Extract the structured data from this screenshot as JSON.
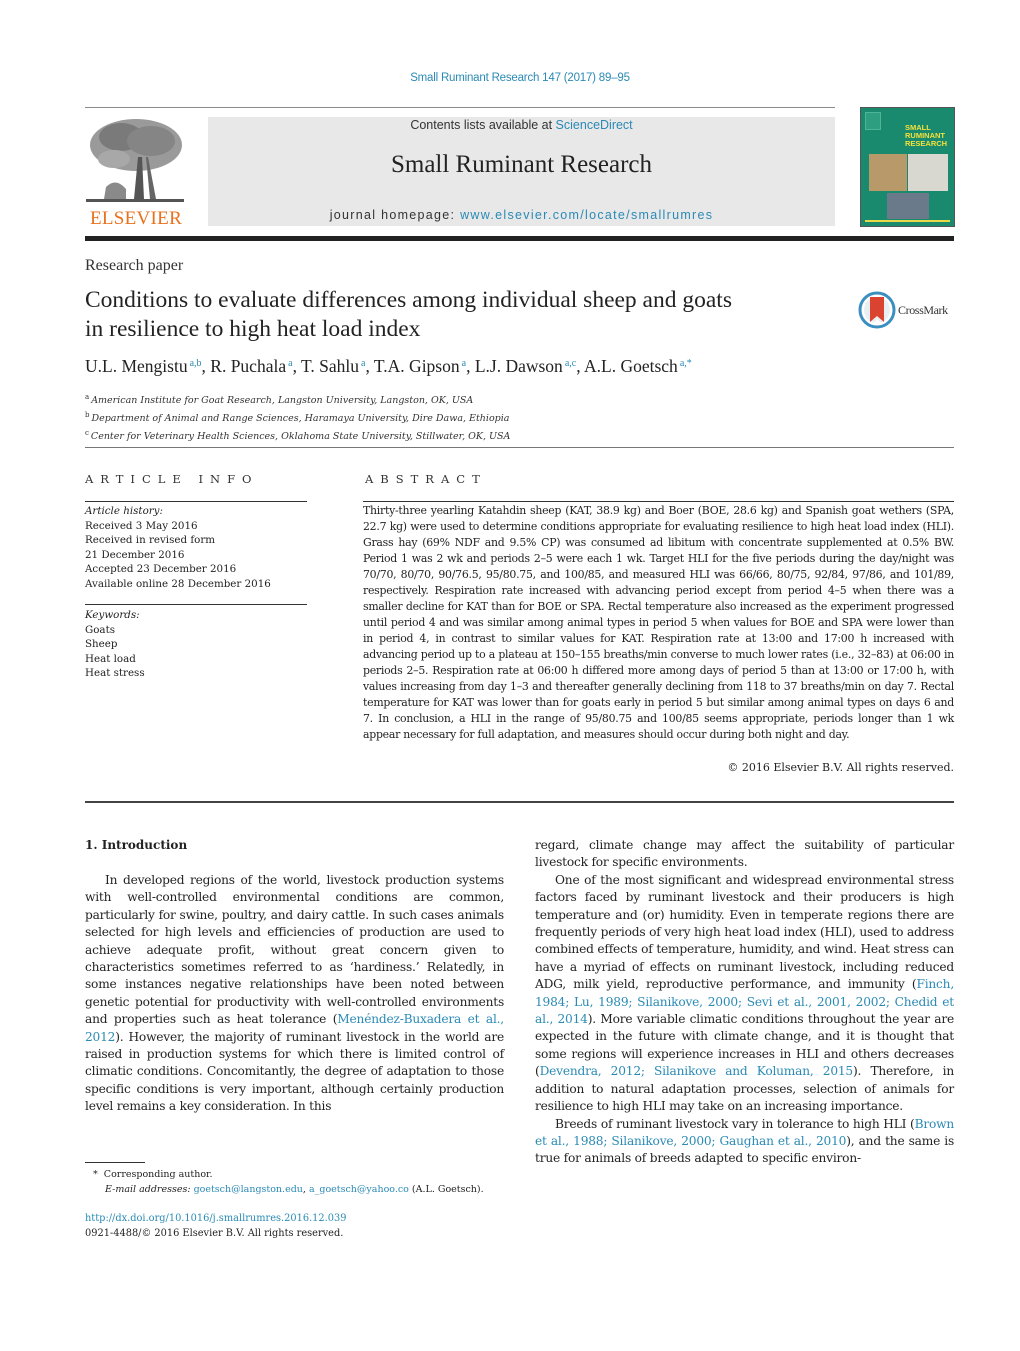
{
  "header": {
    "journal_ref": "Small Ruminant Research 147 (2017) 89–95",
    "contents_prefix": "Contents lists available at ",
    "contents_link": "ScienceDirect",
    "journal_title": "Small Ruminant Research",
    "homepage_prefix": "journal homepage: ",
    "homepage_link": "www.elsevier.com/locate/smallrumres",
    "publisher_logo_text": "ELSEVIER",
    "cover_title_lines": [
      "SMALL",
      "RUMINANT",
      "RESEARCH"
    ]
  },
  "article": {
    "type": "Research paper",
    "title_line1": "Conditions to evaluate differences among individual sheep and goats",
    "title_line2": "in resilience to high heat load index",
    "crossmark_label": "CrossMark",
    "authors": [
      {
        "name": "U.L. Mengistu",
        "sup": "a,b",
        "sep": ", "
      },
      {
        "name": "R. Puchala",
        "sup": "a",
        "sep": ", "
      },
      {
        "name": "T. Sahlu",
        "sup": "a",
        "sep": ", "
      },
      {
        "name": "T.A. Gipson",
        "sup": "a",
        "sep": ", "
      },
      {
        "name": "L.J. Dawson",
        "sup": "a,c",
        "sep": ", "
      },
      {
        "name": "A.L. Goetsch",
        "sup": "a,*",
        "sep": ""
      }
    ],
    "affiliations": [
      {
        "key": "a",
        "text": "American Institute for Goat Research, Langston University, Langston, OK, USA"
      },
      {
        "key": "b",
        "text": "Department of Animal and Range Sciences, Haramaya University, Dire Dawa, Ethiopia"
      },
      {
        "key": "c",
        "text": "Center for Veterinary Health Sciences, Oklahoma State University, Stillwater, OK, USA"
      }
    ]
  },
  "article_info": {
    "heading": "ARTICLE INFO",
    "history_label": "Article history:",
    "history": [
      "Received 3 May 2016",
      "Received in revised form",
      "21 December 2016",
      "Accepted 23 December 2016",
      "Available online 28 December 2016"
    ],
    "keywords_label": "Keywords:",
    "keywords": [
      "Goats",
      "Sheep",
      "Heat load",
      "Heat stress"
    ]
  },
  "abstract": {
    "heading": "ABSTRACT",
    "text": "Thirty-three yearling Katahdin sheep (KAT, 38.9 kg) and Boer (BOE, 28.6 kg) and Spanish goat wethers (SPA, 22.7 kg) were used to determine conditions appropriate for evaluating resilience to high heat load index (HLI). Grass hay (69% NDF and 9.5% CP) was consumed ad libitum with concentrate supplemented at 0.5% BW. Period 1 was 2 wk and periods 2–5 were each 1 wk. Target HLI for the five periods during the day/night was 70/70, 80/70, 90/76.5, 95/80.75, and 100/85, and measured HLI was 66/66, 80/75, 92/84, 97/86, and 101/89, respectively. Respiration rate increased with advancing period except from period 4–5 when there was a smaller decline for KAT than for BOE or SPA. Rectal temperature also increased as the experiment progressed until period 4 and was similar among animal types in period 5 when values for BOE and SPA were lower than in period 4, in contrast to similar values for KAT. Respiration rate at 13:00 and 17:00 h increased with advancing period up to a plateau at 150–155 breaths/min converse to much lower rates (i.e., 32–83) at 06:00 in periods 2–5. Respiration rate at 06:00 h differed more among days of period 5 than at 13:00 or 17:00 h, with values increasing from day 1–3 and thereafter generally declining from 118 to 37 breaths/min on day 7. Rectal temperature for KAT was lower than for goats early in period 5 but similar among animal types on days 6 and 7. In conclusion, a HLI in the range of 95/80.75 and 100/85 seems appropriate, periods longer than 1 wk appear necessary for full adaptation, and measures should occur during both night and day.",
    "copyright": "© 2016 Elsevier B.V. All rights reserved."
  },
  "introduction": {
    "heading": "1.  Introduction",
    "p1": "In developed regions of the world, livestock production systems with well-controlled environmental conditions are common, particularly for swine, poultry, and dairy cattle. In such cases animals selected for high levels and efficiencies of production are used to achieve adequate profit, without great concern given to characteristics sometimes referred to as ‘hardiness.’ Relatedly, in some instances negative relationships have been noted between genetic potential for productivity with well-controlled environments and properties such as heat tolerance (",
    "p1_cite1": "Menéndez-Buxadera et al., 2012",
    "p1_b": "). However, the majority of ruminant livestock in the world are raised in production systems for which there is limited control of climatic conditions. Concomitantly, the degree of adaptation to those specific conditions is very important, although certainly production level remains a key consideration. In this regard, climate change may affect the suitability of particular livestock for specific environments.",
    "p2_a": "One of the most significant and widespread environmental stress factors faced by ruminant livestock and their producers is high temperature and (or) humidity. Even in temperate regions there are frequently periods of very high heat load index (HLI), used to address combined effects of temperature, humidity, and wind. Heat stress can have a myriad of effects on ruminant livestock, including reduced ADG, milk yield, reproductive performance, and immunity (",
    "p2_cite1": "Finch, 1984; Lu, 1989; Silanikove, 2000; Sevi et al., 2001, 2002; Chedid et al., 2014",
    "p2_b": "). More variable climatic conditions throughout the year are expected in the future with climate change, and it is thought that some regions will experience increases in HLI and others decreases (",
    "p2_cite2": "Devendra, 2012; Silanikove and Koluman, 2015",
    "p2_c": "). Therefore, in addition to natural adaptation processes, selection of animals for resilience to high HLI may take on an increasing importance.",
    "p3_a": "Breeds of ruminant livestock vary in tolerance to high HLI (",
    "p3_cite1": "Brown et al., 1988; Silanikove, 2000; Gaughan et al., 2010",
    "p3_b": "), and the same is true for animals of breeds adapted to specific environ-"
  },
  "footnotes": {
    "star": "*",
    "corresponding": "Corresponding author.",
    "email_label": "E-mail addresses:",
    "email1": "goetsch@langston.edu",
    "email_sep": ", ",
    "email2": "a_goetsch@yahoo.co",
    "email_suffix": " (A.L. Goetsch).",
    "doi": "http://dx.doi.org/10.1016/j.smallrumres.2016.12.039",
    "issn": "0921-4488/© 2016 Elsevier B.V. All rights reserved."
  },
  "colors": {
    "link": "#2a8ab5",
    "elsevier_orange": "#e9711c",
    "masthead_bg": "#e8e8e8",
    "cover_green": "#1a8a6e"
  }
}
